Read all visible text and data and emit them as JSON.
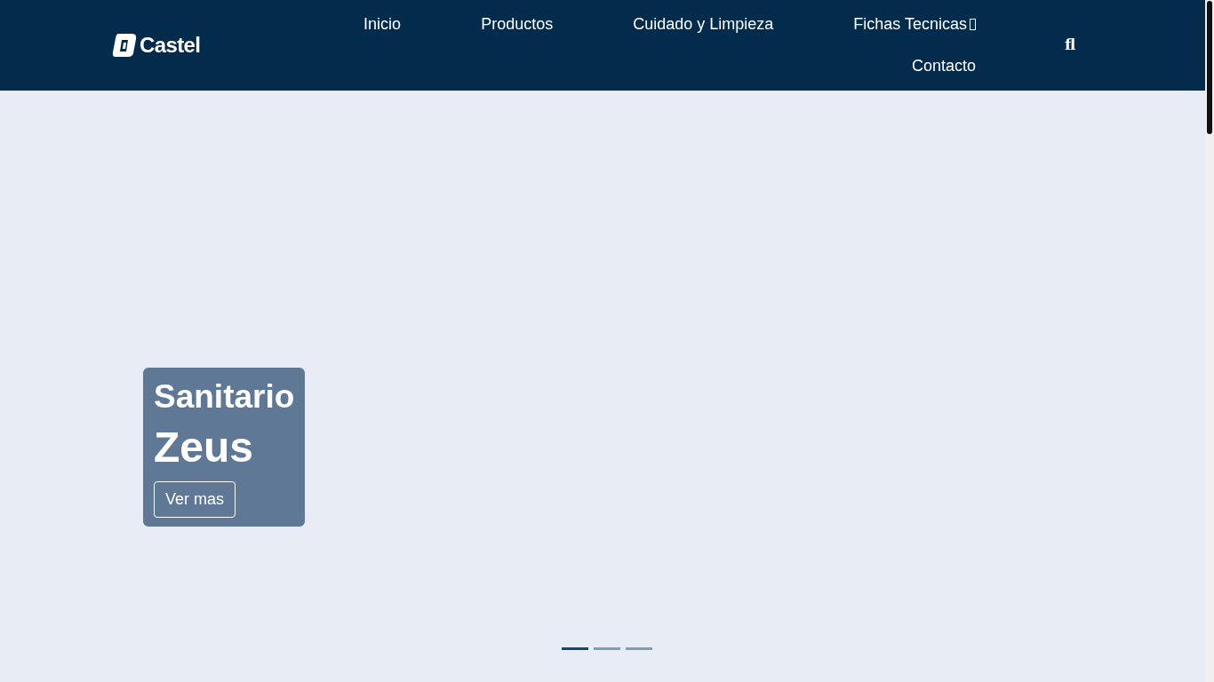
{
  "header": {
    "logo": "Castel",
    "nav": [
      {
        "label": "Inicio",
        "dropdown": false
      },
      {
        "label": "Productos",
        "dropdown": false
      },
      {
        "label": "Cuidado y Limpieza",
        "dropdown": false
      },
      {
        "label": "Fichas Tecnicas",
        "dropdown": true
      },
      {
        "label": "Contacto",
        "dropdown": false
      }
    ],
    "search_glyph": "fl"
  },
  "hero": {
    "subtitle": "Sanitario",
    "title": "Zeus",
    "button": "Ver mas",
    "slides": [
      {
        "selected": true
      },
      {
        "selected": false
      },
      {
        "selected": false
      }
    ]
  }
}
